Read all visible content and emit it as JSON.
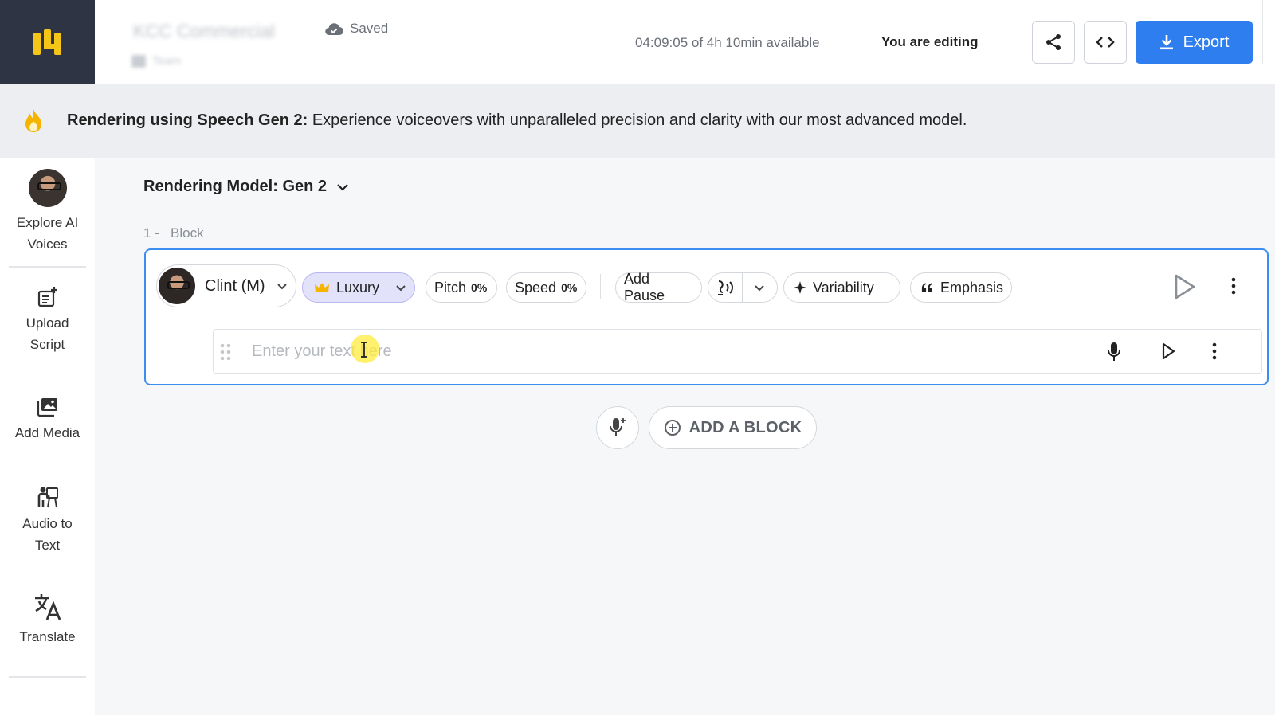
{
  "header": {
    "project_title": "KCC Commercial",
    "project_sub": "Team",
    "saved_status": "Saved",
    "available_time": "04:09:05 of 4h 10min available",
    "editing_status": "You are editing",
    "export_label": "Export"
  },
  "banner": {
    "bold_text": "Rendering using Speech Gen 2:",
    "text": " Experience voiceovers with unparalleled precision and clarity with our most advanced model."
  },
  "sidebar": {
    "items": [
      {
        "label_line1": "Explore AI",
        "label_line2": "Voices"
      },
      {
        "label_line1": "Upload",
        "label_line2": "Script"
      },
      {
        "label_line1": "Add Media",
        "label_line2": ""
      },
      {
        "label_line1": "Audio to",
        "label_line2": "Text"
      },
      {
        "label_line1": "Translate",
        "label_line2": ""
      }
    ]
  },
  "main": {
    "rendering_model": "Rendering Model: Gen 2",
    "block_number": "1 -",
    "block_label": "Block",
    "voice_name": "Clint (M)",
    "style_label": "Luxury",
    "pitch_label": "Pitch",
    "pitch_value": "0%",
    "speed_label": "Speed",
    "speed_value": "0%",
    "add_pause_label": "Add Pause",
    "variability_label": "Variability",
    "emphasis_label": "Emphasis",
    "text_placeholder": "Enter your text here",
    "add_block_label": "ADD A BLOCK"
  },
  "colors": {
    "accent": "#2f7ef0",
    "logo_bg": "#2f3445",
    "logo_yellow": "#f5c518",
    "luxury_bg": "#e3e2fb",
    "flame": "#f5b400"
  }
}
